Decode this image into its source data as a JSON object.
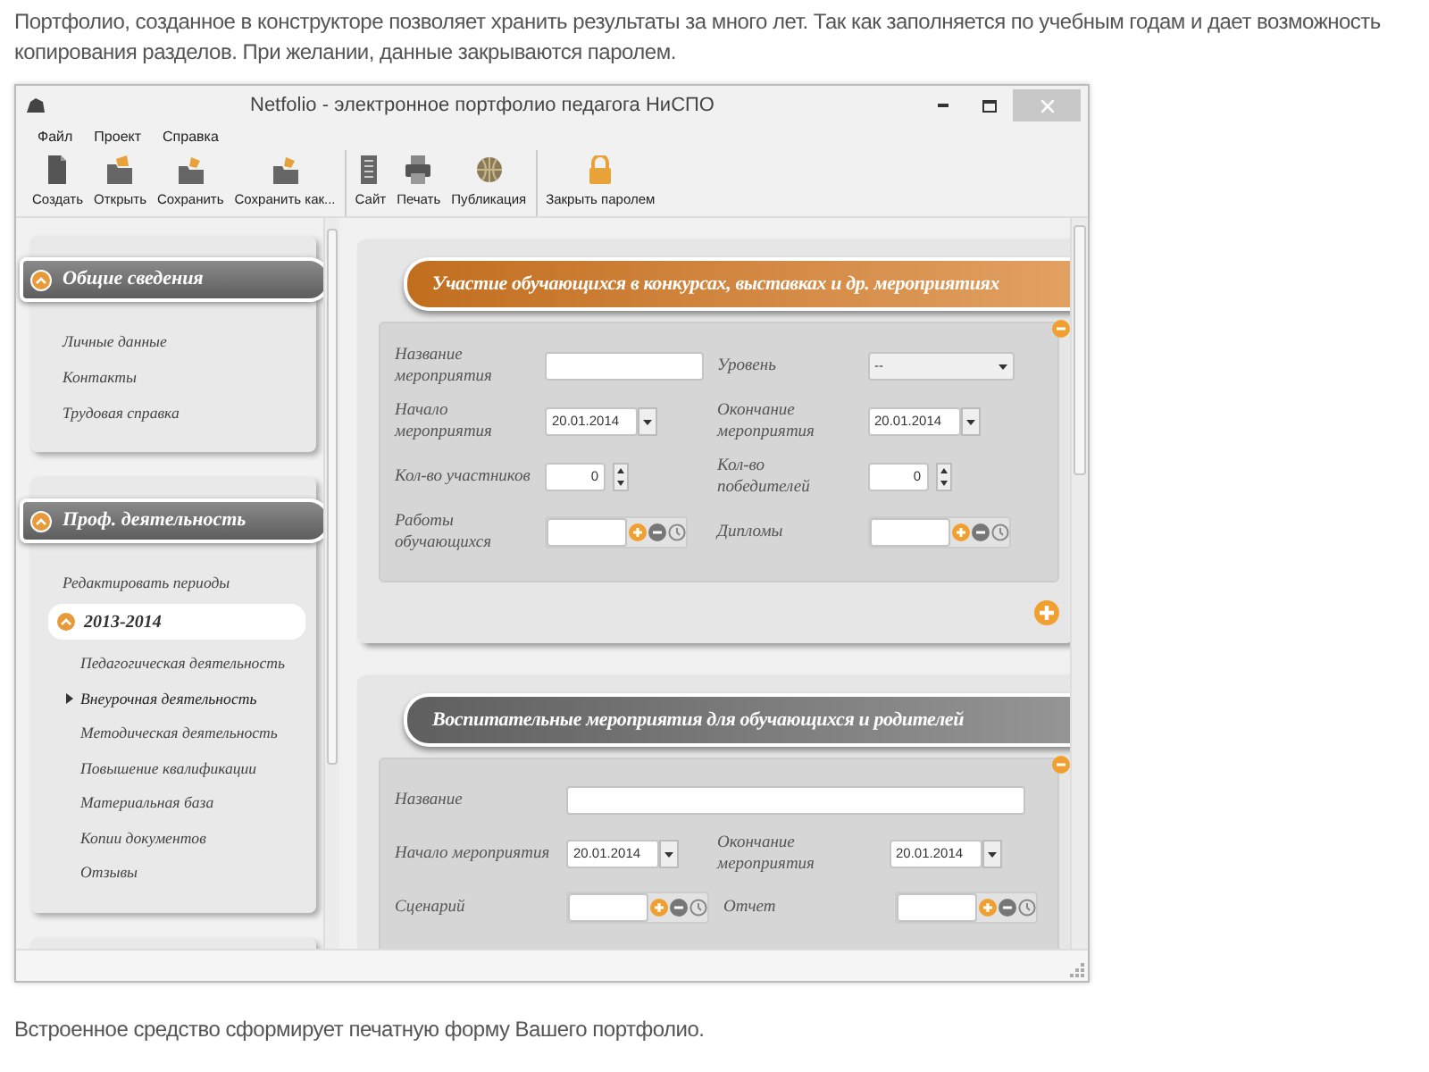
{
  "intro": "Портфолио, созданное в конструкторе позволяет хранить результаты за много лет. Так как заполняется по учебным годам и дает возможность копирования разделов. При желании, данные закрываются паролем.",
  "window": {
    "title": "Netfolio - электронное портфолио педагога НиСПО"
  },
  "menu": [
    "Файл",
    "Проект",
    "Справка"
  ],
  "toolbar": [
    [
      {
        "label": "Создать",
        "kind": "new"
      },
      {
        "label": "Открыть",
        "kind": "open"
      },
      {
        "label": "Сохранить",
        "kind": "save"
      },
      {
        "label": "Сохранить как...",
        "kind": "save"
      }
    ],
    [
      {
        "label": "Сайт",
        "kind": "site"
      },
      {
        "label": "Печать",
        "kind": "print"
      },
      {
        "label": "Публикация",
        "kind": "globe"
      }
    ],
    [
      {
        "label": "Закрыть паролем",
        "kind": "lock"
      }
    ]
  ],
  "sidebar": [
    {
      "title": "Общие сведения",
      "expanded": true,
      "items": [
        {
          "label": "Личные данные"
        },
        {
          "label": "Контакты"
        },
        {
          "label": "Трудовая справка"
        }
      ]
    },
    {
      "title": "Проф. деятельность",
      "expanded": true,
      "items": [
        {
          "label": "Редактировать периоды"
        },
        {
          "label": "2013-2014",
          "kind": "period",
          "expanded": true,
          "children": [
            {
              "label": "Педагогическая деятельность",
              "selected": false
            },
            {
              "label": "Внеурочная деятельность",
              "selected": true
            },
            {
              "label": "Методическая деятельность",
              "selected": false
            },
            {
              "label": "Повышение квалификации",
              "selected": false
            },
            {
              "label": "Материальная база",
              "selected": false
            },
            {
              "label": "Копии документов",
              "selected": false
            },
            {
              "label": "Отзывы",
              "selected": false
            }
          ]
        }
      ]
    }
  ],
  "panels": [
    {
      "title": "Участие обучающихся в конкурсах, выставках и др. мероприятиях",
      "color": "#d77a22",
      "add_button": true,
      "rows": [
        [
          {
            "label": "Название мероприятия",
            "kind": "text"
          },
          {
            "label": "Уровень",
            "kind": "select",
            "value": "--"
          }
        ],
        [
          {
            "label": "Начало мероприятия",
            "kind": "date",
            "value": "20.01.2014"
          },
          {
            "label": "Окончание мероприятия",
            "kind": "date",
            "value": "20.01.2014"
          }
        ],
        [
          {
            "label": "Кол-во участников",
            "kind": "spin",
            "value": "0"
          },
          {
            "label": "Кол-во победителей",
            "kind": "spin",
            "value": "0"
          }
        ],
        [
          {
            "label": "Работы обучающихся",
            "kind": "attach"
          },
          {
            "label": "Дипломы",
            "kind": "attach"
          }
        ]
      ]
    },
    {
      "title": "Воспитательные мероприятия для обучающихся и родителей",
      "color": "#6a6a6a",
      "rows": [
        [
          {
            "label": "Название",
            "kind": "text"
          }
        ],
        [
          {
            "label": "Начало мероприятия",
            "kind": "date",
            "value": "20.01.2014"
          },
          {
            "label": "Окончание мероприятия",
            "kind": "date",
            "value": "20.01.2014"
          }
        ],
        [
          {
            "label": "Сценарий",
            "kind": "attach"
          },
          {
            "label": "Отчет",
            "kind": "attach"
          }
        ]
      ]
    }
  ],
  "outro": "Встроенное средство сформирует печатную форму Вашего портфолио."
}
